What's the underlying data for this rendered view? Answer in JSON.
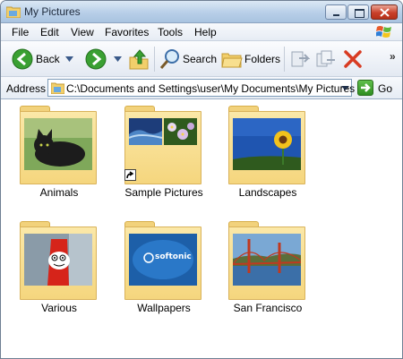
{
  "window": {
    "title": "My Pictures"
  },
  "menu": [
    "File",
    "Edit",
    "View",
    "Favorites",
    "Tools",
    "Help"
  ],
  "toolbar": {
    "back_label": "Back",
    "search_label": "Search",
    "folders_label": "Folders",
    "overflow_label": "»"
  },
  "address": {
    "label": "Address",
    "value": "C:\\Documents and Settings\\user\\My Documents\\My Pictures",
    "go_label": "Go"
  },
  "folders": [
    {
      "name": "Animals"
    },
    {
      "name": "Sample Pictures"
    },
    {
      "name": "Landscapes"
    },
    {
      "name": "Various"
    },
    {
      "name": "Wallpapers",
      "thumb_text": "softonic"
    },
    {
      "name": "San Francisco"
    }
  ]
}
